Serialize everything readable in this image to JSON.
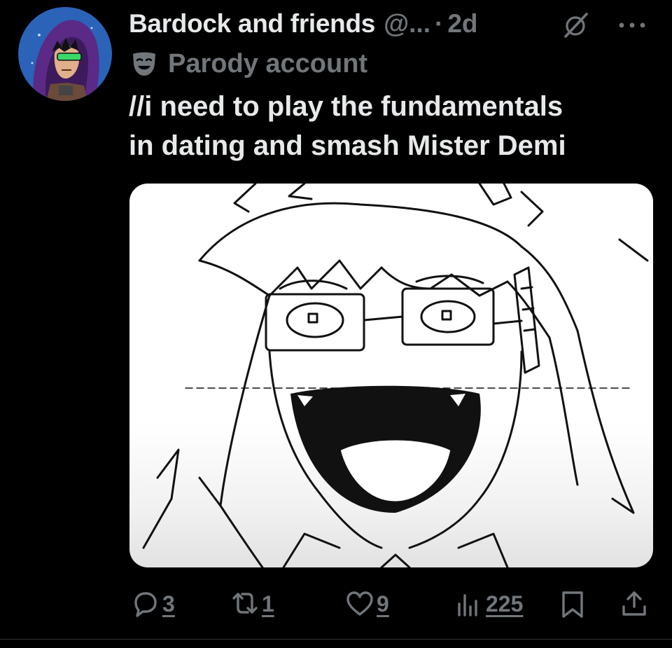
{
  "post": {
    "display_name": "Bardock and friends",
    "handle": "@...",
    "separator": "·",
    "time": "2d",
    "label": "Parody account",
    "text_lines": [
      "//i need to play the fundamentals",
      "in dating and smash Mister Demi"
    ]
  },
  "icons": {
    "avatar": "avatar",
    "grok": "grok-icon",
    "more": "more-icon",
    "label": "parody-mask-icon",
    "reply": "reply-icon",
    "repost": "repost-icon",
    "like": "like-icon",
    "views": "views-icon",
    "bookmark": "bookmark-icon",
    "share": "share-icon"
  },
  "actions": {
    "replies": "3",
    "reposts": "1",
    "likes": "9",
    "views": "225"
  },
  "colors": {
    "background": "#000000",
    "primary_text": "#e7e9ea",
    "secondary_text": "#71767b",
    "divider": "#2f3336"
  }
}
